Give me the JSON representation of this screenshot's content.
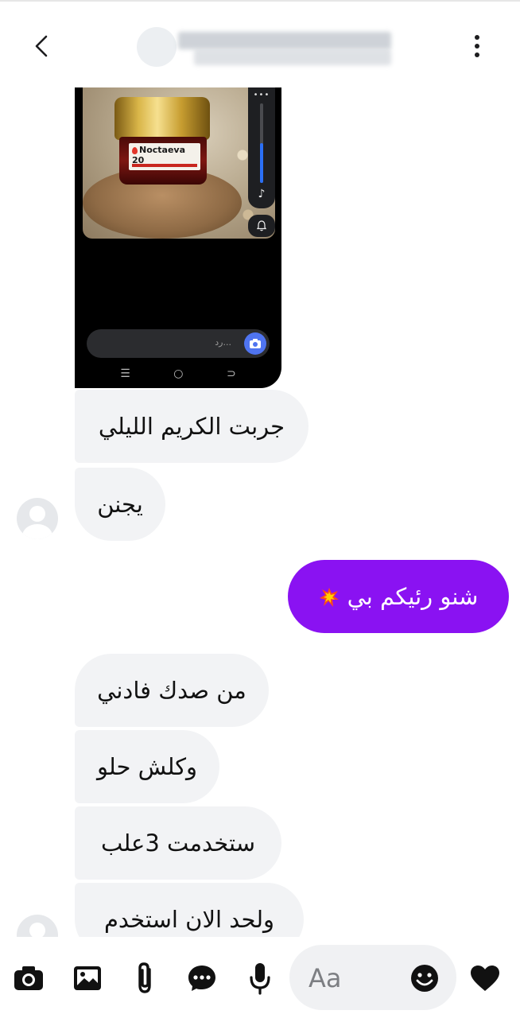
{
  "header": {
    "back_icon": "chevron-left-icon",
    "menu_icon": "more-vertical-icon"
  },
  "shared_screenshot": {
    "product_label": "Noctaeva 20",
    "input_placeholder": "رد...",
    "music_icon": "♪",
    "bell_icon": "bell-icon",
    "nav": [
      "☰",
      "○",
      "⊃"
    ]
  },
  "messages": [
    {
      "side": "in",
      "text": "جربت الكريم الليلي"
    },
    {
      "side": "in",
      "text": "يجنن"
    },
    {
      "side": "out",
      "text": "شنو رئيكم بي",
      "emoji": "collision-emoji"
    },
    {
      "side": "in",
      "text": "من صدك فادني"
    },
    {
      "side": "in",
      "text": "وكلش حلو"
    },
    {
      "side": "in",
      "text": "ستخدمت 3علب"
    },
    {
      "side": "in",
      "text": "ولحد الان استخدم"
    }
  ],
  "composer": {
    "placeholder": "Aa",
    "tools": [
      "camera-icon",
      "gallery-icon",
      "attachment-icon",
      "chat-bubble-icon",
      "microphone-icon"
    ],
    "emoji_icon": "smile-icon",
    "like_icon": "heart-icon"
  },
  "colors": {
    "outgoing_bubble": "#8a12f2",
    "incoming_bubble": "#f2f3f5"
  }
}
